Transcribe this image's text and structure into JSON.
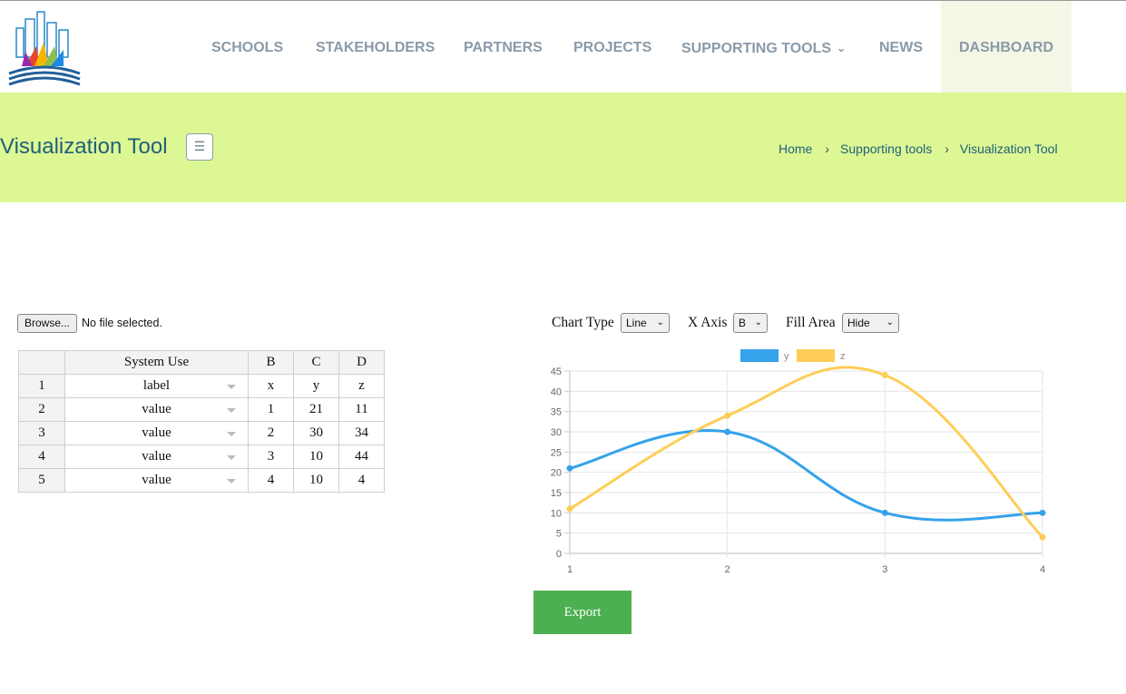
{
  "nav": {
    "items": [
      "SCHOOLS",
      "STAKEHOLDERS",
      "PARTNERS",
      "PROJECTS",
      "SUPPORTING TOOLS",
      "NEWS",
      "DASHBOARD"
    ]
  },
  "page": {
    "title": "Visualization Tool",
    "breadcrumb": [
      "Home",
      "Supporting tools",
      "Visualization Tool"
    ]
  },
  "file": {
    "button": "Browse...",
    "status": "No file selected."
  },
  "table": {
    "headers": [
      "System Use",
      "B",
      "C",
      "D"
    ],
    "rows": [
      {
        "num": "1",
        "use": "label",
        "b": "x",
        "c": "y",
        "d": "z"
      },
      {
        "num": "2",
        "use": "value",
        "b": "1",
        "c": "21",
        "d": "11"
      },
      {
        "num": "3",
        "use": "value",
        "b": "2",
        "c": "30",
        "d": "34"
      },
      {
        "num": "4",
        "use": "value",
        "b": "3",
        "c": "10",
        "d": "44"
      },
      {
        "num": "5",
        "use": "value",
        "b": "4",
        "c": "10",
        "d": "4"
      }
    ]
  },
  "controls": {
    "chart_type_label": "Chart Type",
    "chart_type_value": "Line",
    "x_axis_label": "X Axis",
    "x_axis_value": "B",
    "fill_area_label": "Fill Area",
    "fill_area_value": "Hide"
  },
  "export_label": "Export",
  "colors": {
    "series_y": "#36a2eb",
    "series_z": "#ffcd56",
    "band": "#ddf795",
    "export": "#4caf50"
  },
  "chart_data": {
    "type": "line",
    "x": [
      1,
      2,
      3,
      4
    ],
    "series": [
      {
        "name": "y",
        "values": [
          21,
          30,
          10,
          10
        ]
      },
      {
        "name": "z",
        "values": [
          11,
          34,
          44,
          4
        ]
      }
    ],
    "ylim": [
      0,
      45
    ],
    "yticks": [
      0,
      5,
      10,
      15,
      20,
      25,
      30,
      35,
      40,
      45
    ],
    "xticks": [
      1,
      2,
      3,
      4
    ],
    "grid": true,
    "legend": "top"
  }
}
